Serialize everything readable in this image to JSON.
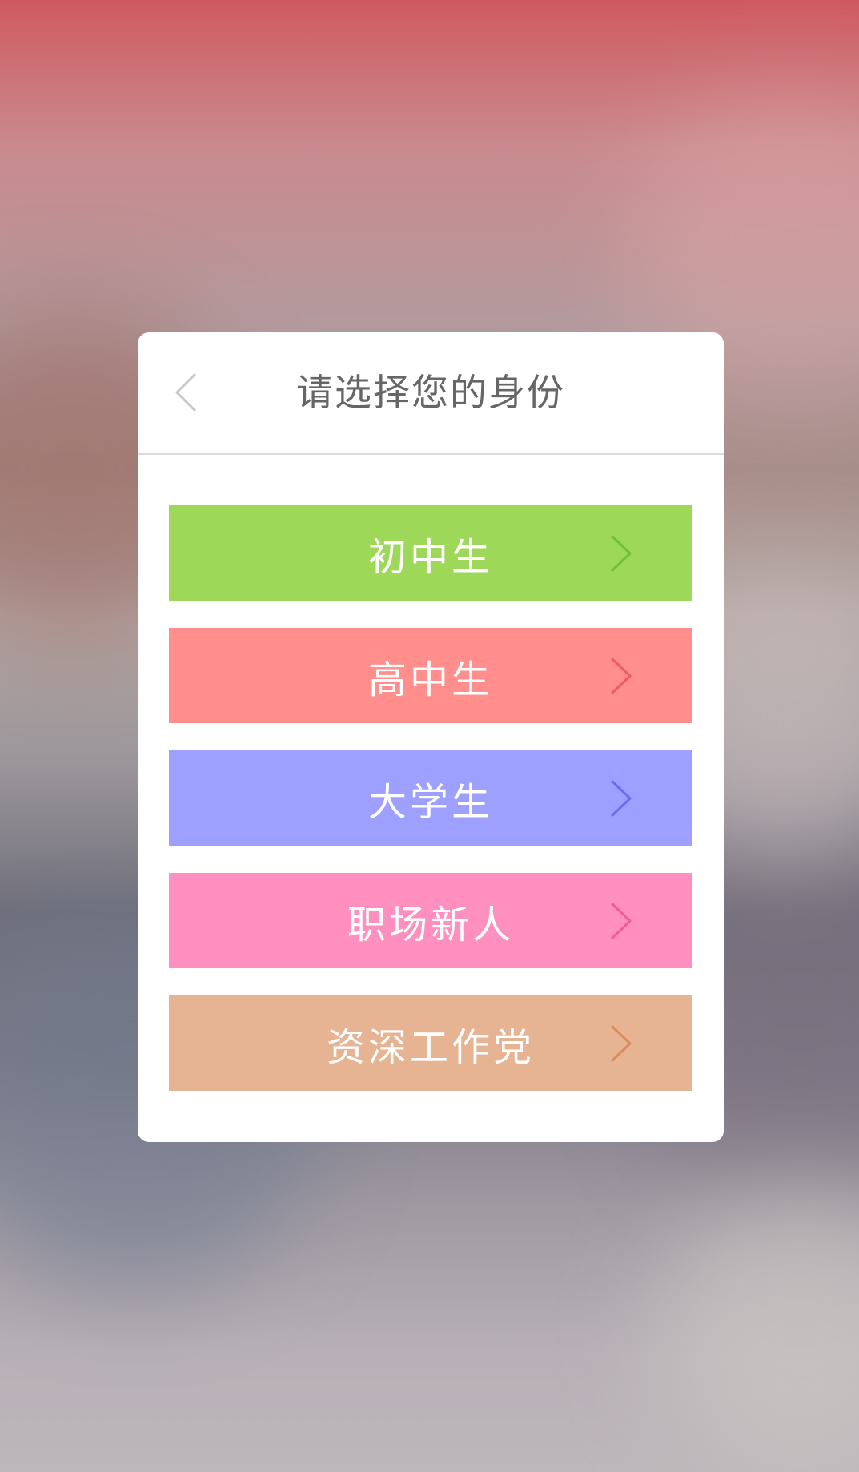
{
  "dialog": {
    "title": "请选择您的身份",
    "back_icon": "chevron-left-icon",
    "options": [
      {
        "label": "初中生",
        "color": "#9ed858",
        "arrow_color": "#6cc23c",
        "icon": "chevron-right-icon"
      },
      {
        "label": "高中生",
        "color": "#ff8e8c",
        "arrow_color": "#f25a62",
        "icon": "chevron-right-icon"
      },
      {
        "label": "大学生",
        "color": "#9ea0ff",
        "arrow_color": "#6c6cf2",
        "icon": "chevron-right-icon"
      },
      {
        "label": "职场新人",
        "color": "#ff8fbf",
        "arrow_color": "#f25c94",
        "icon": "chevron-right-icon"
      },
      {
        "label": "资深工作党",
        "color": "#e6b393",
        "arrow_color": "#e08a5c",
        "icon": "chevron-right-icon"
      }
    ]
  }
}
